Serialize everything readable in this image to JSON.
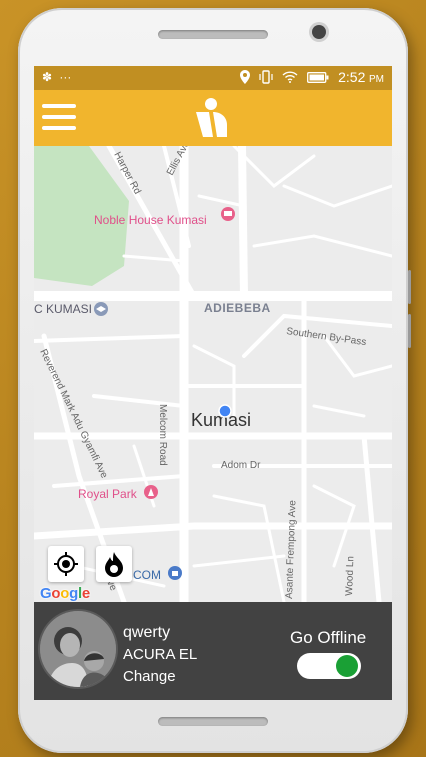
{
  "status_bar": {
    "time": "2:52",
    "ampm": "PM",
    "left_icons": [
      "notification-icon",
      "more-dots-icon"
    ],
    "right_icons": [
      "location-icon",
      "vibrate-icon",
      "wifi-icon",
      "battery-icon"
    ]
  },
  "app_bar": {
    "menu_icon": "hamburger-menu-icon",
    "logo_icon": "app-logo-icon",
    "color": "#f1b52d"
  },
  "map": {
    "places": {
      "noble_house": "Noble House Kumasi",
      "knust": "C KUMASI",
      "adiebeba": "ADIEBEBA",
      "kumasi": "Kumasi",
      "royal_park": "Royal Park",
      "com": "COM"
    },
    "streets": {
      "harper": "Harper Rd",
      "ellis": "Ellis Ave",
      "southern": "Southern By-Pass",
      "reverend": "Reverend Mark Adu Gyamfi Ave",
      "melcom": "Melcom Road",
      "adom": "Adom Dr",
      "asante": "Asante Frempong Ave",
      "wood": "Wood Ln",
      "short_ave": "Ave"
    },
    "attribution": "Google",
    "controls": [
      "my-location-icon",
      "fire-icon"
    ],
    "pin_color": "#e8618a",
    "location_dot_color": "#4285f4"
  },
  "driver": {
    "name": "qwerty",
    "car": "ACURA EL",
    "change_label": "Change",
    "status_label": "Go Offline",
    "online": true,
    "toggle_color": "#1aa035"
  }
}
